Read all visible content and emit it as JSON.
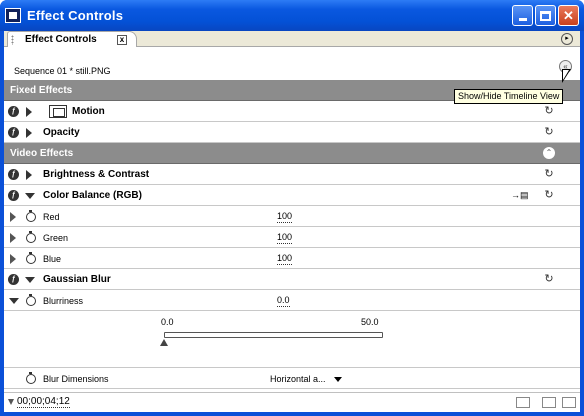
{
  "window": {
    "title": "Effect Controls",
    "close_glyph": "✕"
  },
  "tab": {
    "label": "Effect Controls",
    "close_glyph": "x",
    "menu_glyph": "▸"
  },
  "sequence": {
    "label": "Sequence 01 * still.PNG",
    "toggle_glyph": "«"
  },
  "tooltip": "Show/Hide Timeline View",
  "sections": {
    "fixed": "Fixed Effects",
    "video": "Video Effects"
  },
  "effects": {
    "motion": "Motion",
    "opacity": "Opacity",
    "brightness": "Brightness & Contrast",
    "color_balance": "Color Balance (RGB)",
    "gaussian_blur": "Gaussian Blur"
  },
  "properties": {
    "red": {
      "label": "Red",
      "value": "100"
    },
    "green": {
      "label": "Green",
      "value": "100"
    },
    "blue": {
      "label": "Blue",
      "value": "100"
    },
    "blurriness": {
      "label": "Blurriness",
      "value": "0.0"
    },
    "blur_dimensions": {
      "label": "Blur Dimensions",
      "value": "Horizontal a..."
    }
  },
  "slider": {
    "min": "0.0",
    "max": "50.0",
    "value": 0.0
  },
  "icons": {
    "fx": "ƒ",
    "reset": "↻",
    "collapse": "⌃",
    "prop_icon": "→▤"
  },
  "status": {
    "timecode": "00;00;04;12"
  },
  "colors": {
    "title_bar": "#0a58e0",
    "section_header": "#8c8c8c",
    "tooltip_bg": "#ffffe1"
  }
}
